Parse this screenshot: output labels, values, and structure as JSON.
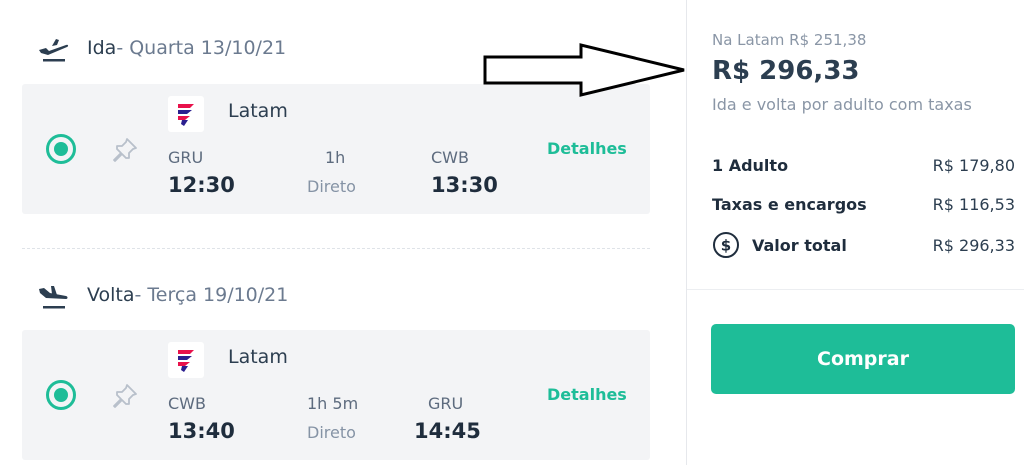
{
  "outbound": {
    "label": "Ida",
    "date": " - Quarta 13/10/21",
    "airline": "Latam",
    "origin": "GRU",
    "depart": "12:30",
    "duration": "1h",
    "stops": "Direto",
    "destination": "CWB",
    "arrive": "13:30",
    "details": "Detalhes"
  },
  "return": {
    "label": "Volta",
    "date": " - Terça 19/10/21",
    "airline": "Latam",
    "origin": "CWB",
    "depart": "13:40",
    "duration": "1h 5m",
    "stops": "Direto",
    "destination": "GRU",
    "arrive": "14:45",
    "details": "Detalhes"
  },
  "summary": {
    "latam_price": "Na Latam R$ 251,38",
    "price": "R$ 296,33",
    "price_note": "Ida e volta por adulto com taxas",
    "rows": [
      {
        "label": "1 Adulto",
        "value": "R$ 179,80"
      },
      {
        "label": "Taxas e encargos",
        "value": "R$ 116,53"
      },
      {
        "label": "Valor total",
        "value": "R$ 296,33"
      }
    ],
    "buy_label": "Comprar"
  },
  "colors": {
    "accent": "#1ebd98",
    "card_bg": "#f3f4f6",
    "text_dark": "#2c3e50"
  },
  "icons": [
    "plane-takeoff-icon",
    "plane-landing-icon",
    "radio-selected-icon",
    "pin-icon",
    "latam-logo",
    "dollar-circle-icon",
    "arrow-annotation"
  ]
}
